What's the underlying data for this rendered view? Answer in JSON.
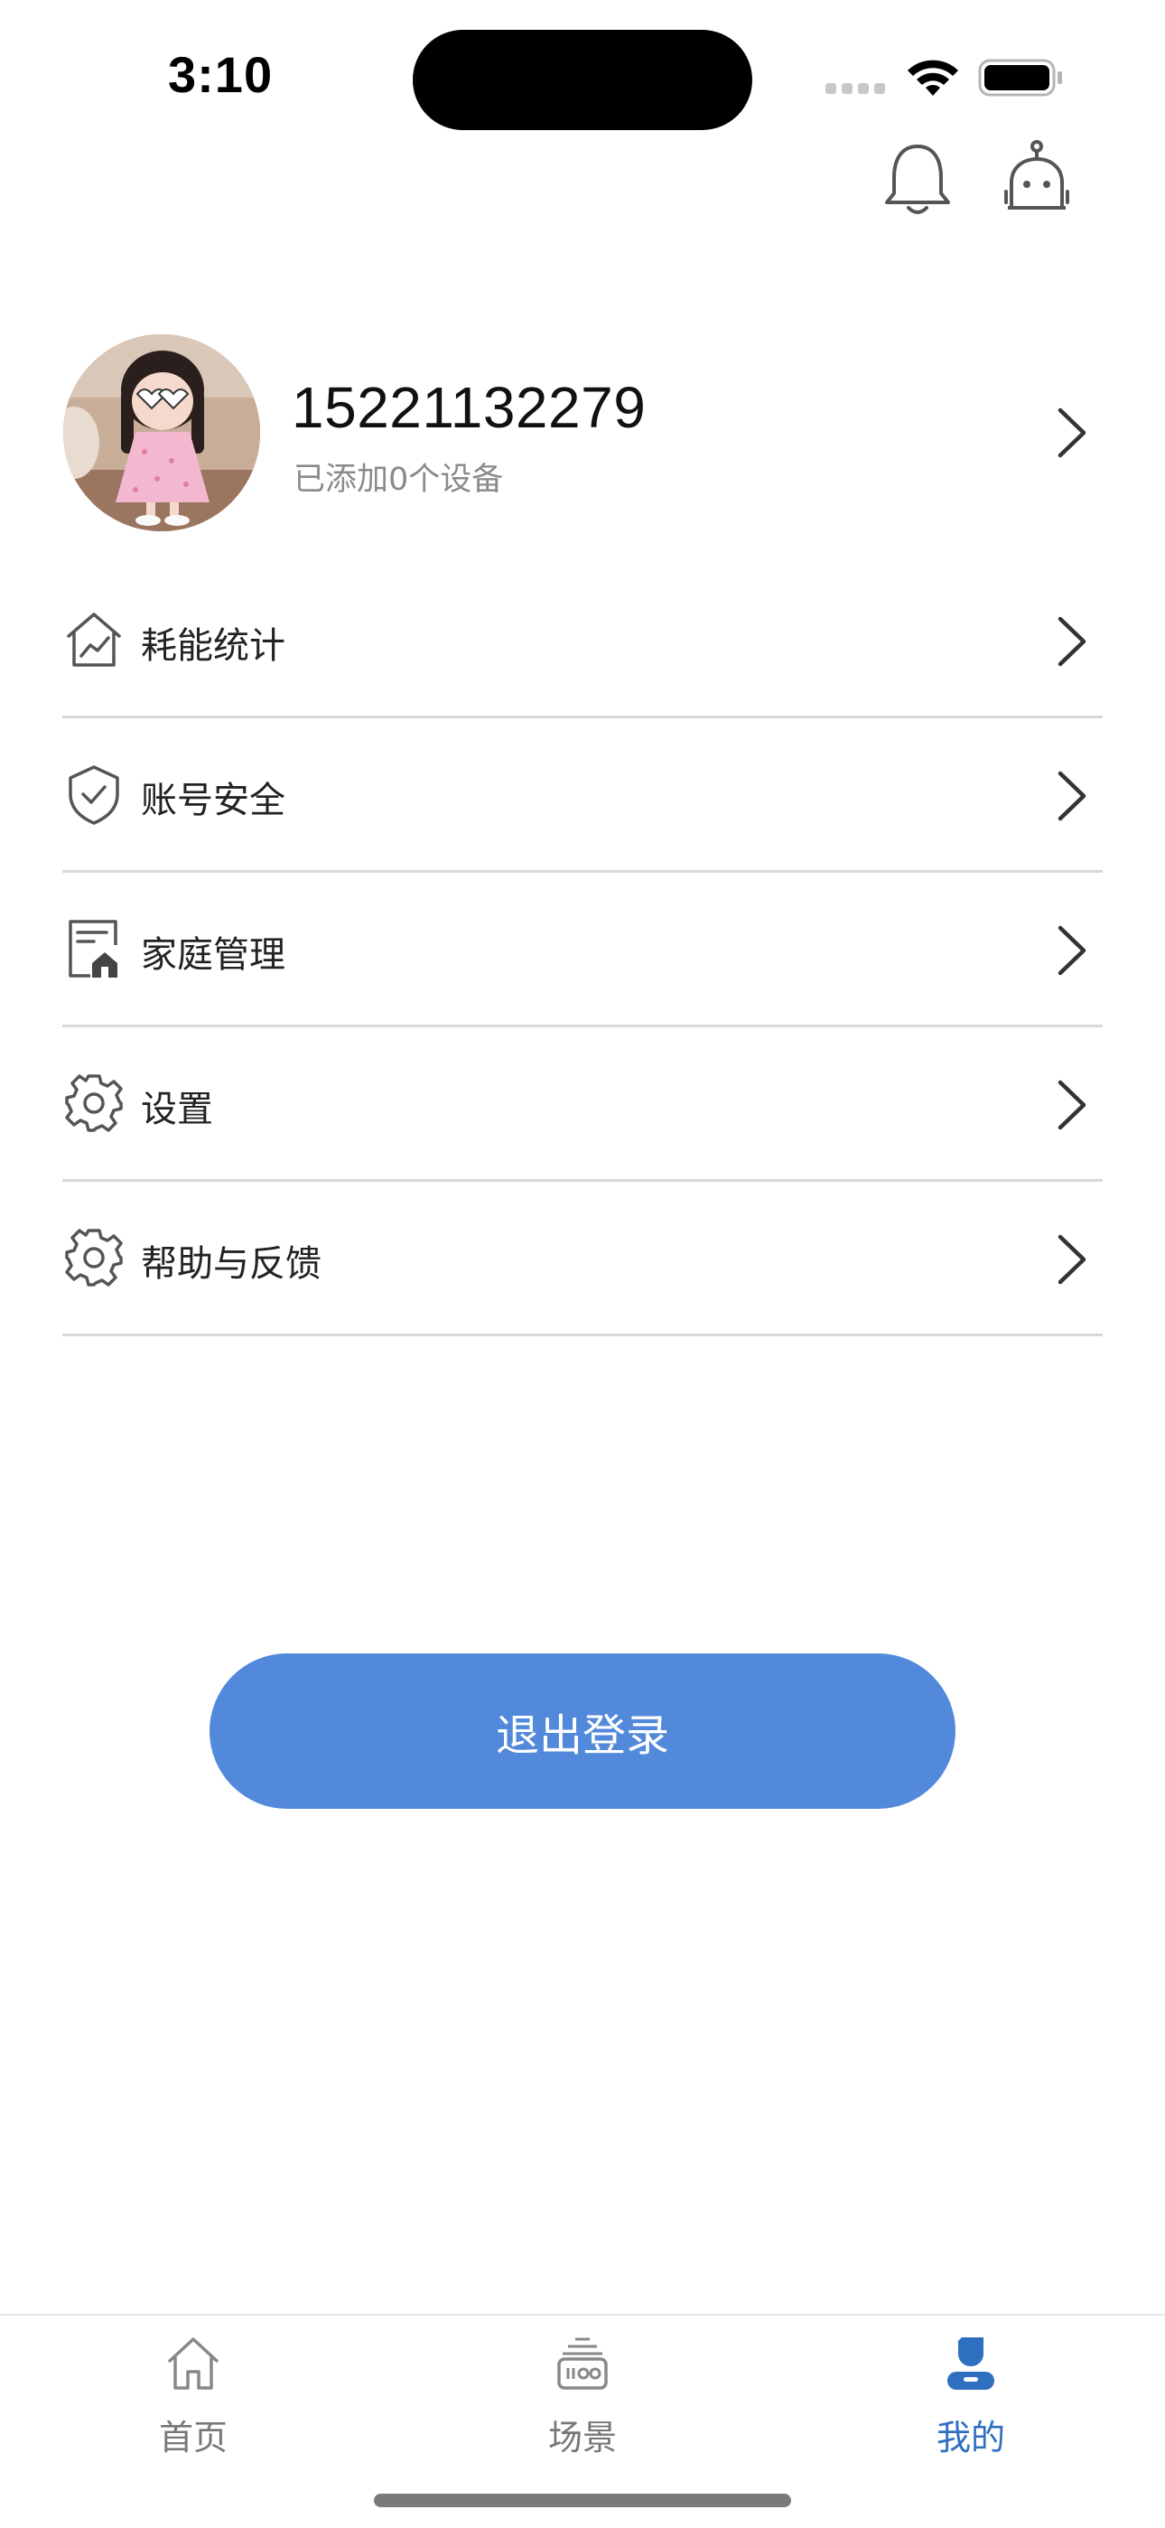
{
  "status_bar": {
    "time": "3:10",
    "wifi_icon": "wifi-icon",
    "battery_icon": "battery-icon"
  },
  "header": {
    "notification_icon": "bell-icon",
    "assistant_icon": "robot-icon"
  },
  "profile": {
    "phone": "15221132279",
    "device_count_text": "已添加0个设备",
    "avatar": "avatar-image"
  },
  "menu": {
    "items": [
      {
        "label": "耗能统计",
        "icon": "energy-chart-icon"
      },
      {
        "label": "账号安全",
        "icon": "shield-icon"
      },
      {
        "label": "家庭管理",
        "icon": "home-manage-icon"
      },
      {
        "label": "设置",
        "icon": "gear-icon"
      },
      {
        "label": "帮助与反馈",
        "icon": "gear-icon"
      }
    ]
  },
  "logout": {
    "label": "退出登录",
    "color": "#5289db"
  },
  "tab_bar": {
    "tabs": [
      {
        "label": "首页",
        "icon": "home-icon",
        "active": false
      },
      {
        "label": "场景",
        "icon": "scene-icon",
        "active": false
      },
      {
        "label": "我的",
        "icon": "profile-icon",
        "active": true
      }
    ],
    "active_color": "#2f6fc0",
    "inactive_color": "#777777"
  }
}
